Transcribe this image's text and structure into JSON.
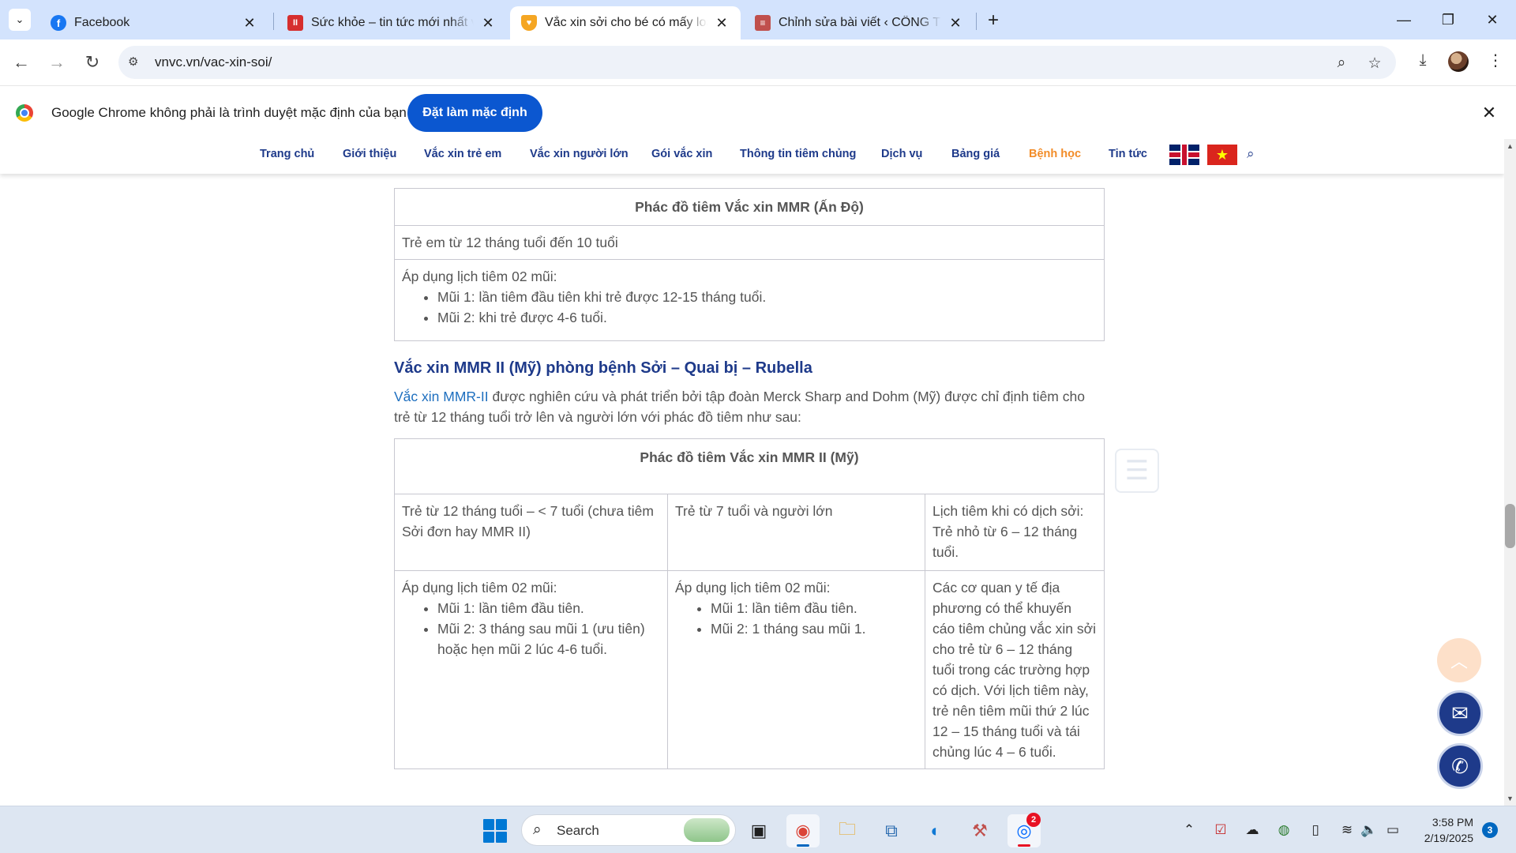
{
  "browser": {
    "tabs": [
      {
        "title": "Facebook",
        "icon": "facebook-icon",
        "color": "#1877f2",
        "glyph": "f"
      },
      {
        "title": "Sức khỏe – tin tức mới nhất về sức khỏe",
        "icon": "news-icon",
        "color": "#d62e2e",
        "glyph": "II"
      },
      {
        "title": "Vắc xin sởi cho bé có mấy loại? Lịch tiêm",
        "icon": "vnvc-shield-icon",
        "color": "#f5a623",
        "glyph": "♥"
      },
      {
        "title": "Chỉnh sửa bài viết ‹ CÔNG TY TNHH",
        "icon": "wordpress-icon",
        "color": "#c0504d",
        "glyph": "≡"
      }
    ],
    "url": "vnvc.vn/vac-xin-soi/",
    "infobar": {
      "message": "Google Chrome không phải là trình duyệt mặc định của bạn",
      "button": "Đặt làm mặc định"
    }
  },
  "site": {
    "nav": [
      "Trang chủ",
      "Giới thiệu",
      "Vắc xin trẻ em",
      "Vắc xin người lớn",
      "Gói vắc xin",
      "Thông tin tiêm chủng",
      "Dịch vụ",
      "Bảng giá",
      "Bệnh học",
      "Tin tức"
    ],
    "active_nav": "Bệnh học",
    "accent_color": "#1e3a8a",
    "active_color": "#f28c28"
  },
  "article": {
    "table1": {
      "title": "Phác đồ tiêm Vắc xin MMR (Ấn Độ)",
      "row1": "Trẻ em từ 12 tháng tuổi đến 10 tuổi",
      "row2_intro": "Áp dụng lịch tiêm 02 mũi:",
      "row2_items": [
        "Mũi 1: lần tiêm đầu tiên khi trẻ được 12-15 tháng tuổi.",
        "Mũi 2: khi trẻ được 4-6 tuổi."
      ]
    },
    "heading": "Vắc xin MMR II (Mỹ) phòng bệnh Sởi – Quai bị – Rubella",
    "para_link": "Vắc xin MMR-II",
    "para_text": " được nghiên cứu và phát triển bởi tập đoàn Merck Sharp and Dohm (Mỹ) được chỉ định tiêm cho trẻ từ 12 tháng tuổi trở lên và người lớn với phác đồ tiêm như sau:",
    "table2": {
      "title": "Phác đồ tiêm Vắc xin MMR II (Mỹ)",
      "col1_head": "Trẻ từ 12 tháng tuổi – < 7 tuổi (chưa tiêm Sởi đơn hay MMR II)",
      "col2_head": "Trẻ từ 7 tuổi và người lớn",
      "col3_head": "Lịch tiêm khi có dịch sởi: Trẻ nhỏ từ 6 – 12 tháng tuổi.",
      "col1_intro": "Áp dụng lịch tiêm 02 mũi:",
      "col1_items": [
        "Mũi 1: lần tiêm đầu tiên.",
        "Mũi 2: 3 tháng sau mũi 1 (ưu tiên) hoặc hẹn mũi 2 lúc 4-6 tuổi."
      ],
      "col2_intro": "Áp dụng lịch tiêm 02 mũi:",
      "col2_items": [
        "Mũi 1: lần tiêm đầu tiên.",
        "Mũi 2: 1 tháng sau mũi 1."
      ],
      "col3_body": "Các cơ quan y tế địa phương có thể khuyến cáo tiêm chủng vắc xin sởi cho trẻ từ 6 – 12 tháng tuổi trong các trường hợp có dịch. Với lịch tiêm này, trẻ nên tiêm mũi thứ 2 lúc 12 – 15 tháng tuổi và tái chủng lúc 4 – 6 tuổi."
    }
  },
  "taskbar": {
    "search_label": "Search",
    "time": "3:58 PM",
    "date": "2/19/2025",
    "zalo_badge": "2",
    "notifications": "3"
  }
}
